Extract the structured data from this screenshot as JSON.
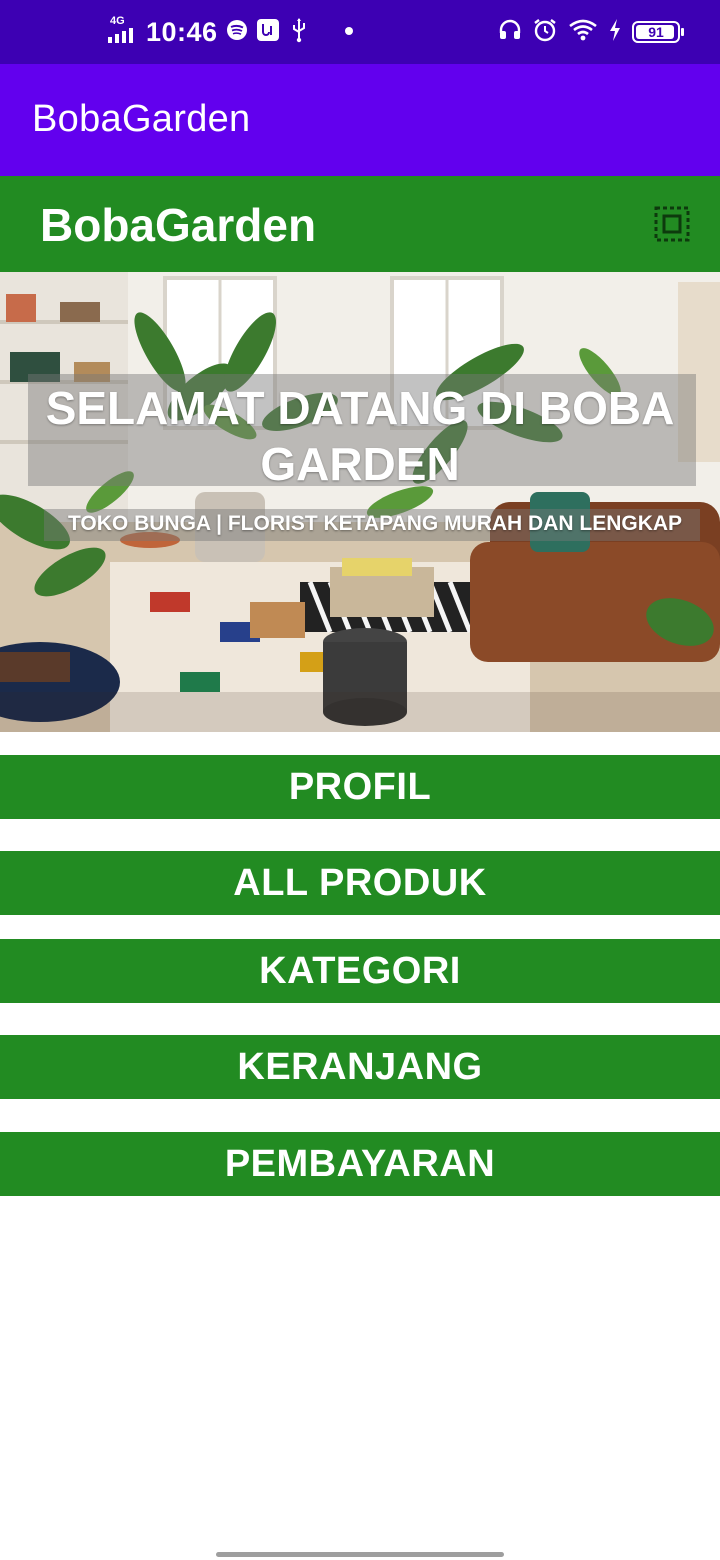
{
  "status_bar": {
    "network": "4G",
    "time": "10:46",
    "battery": "91",
    "icons": [
      "signal-icon",
      "spotify-icon",
      "app-notification-icon",
      "usb-icon",
      "dot-icon",
      "headphones-icon",
      "alarm-icon",
      "wifi-icon",
      "charging-icon",
      "battery-icon"
    ]
  },
  "app_bar": {
    "title": "BobaGarden"
  },
  "header": {
    "title": "BobaGarden",
    "menu_icon": "dotted-square-icon"
  },
  "hero": {
    "title": "SELAMAT DATANG DI BOBA GARDEN",
    "subtitle": "TOKO BUNGA | FLORIST KETAPANG MURAH DAN LENGKAP"
  },
  "menu": {
    "profil": "PROFIL",
    "all_produk": "ALL PRODUK",
    "kategori": "KATEGORI",
    "keranjang": "KERANJANG",
    "pembayaran": "PEMBAYARAN"
  },
  "colors": {
    "status_bar": "#3d00b3",
    "app_bar": "#6200ee",
    "green": "#228b22"
  }
}
